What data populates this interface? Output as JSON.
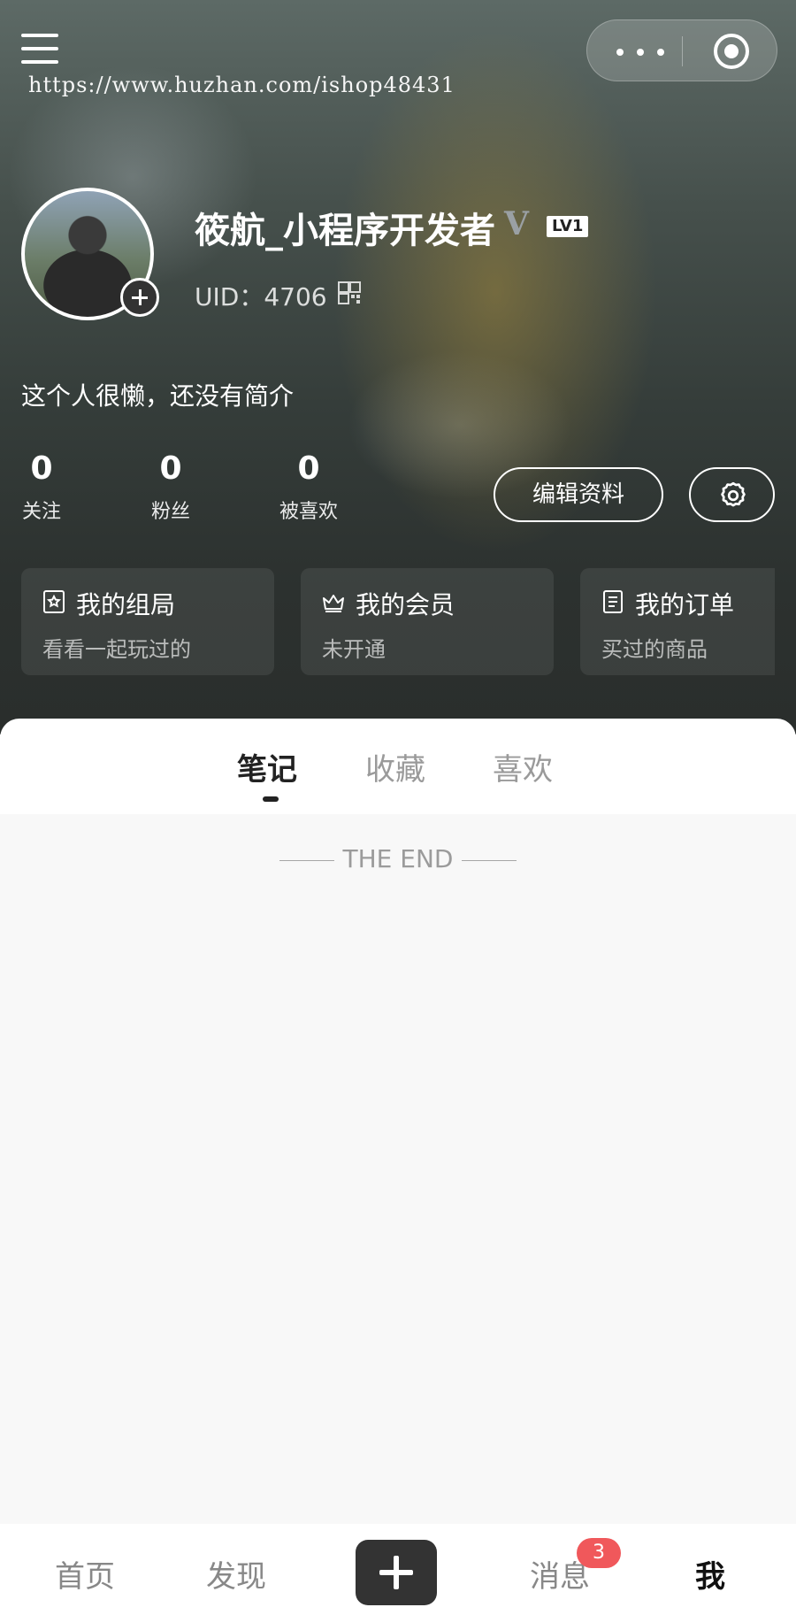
{
  "watermark": "https://www.huzhan.com/ishop48431",
  "icons": {
    "menu": "menu-icon",
    "more": "more-icon",
    "target": "target-icon",
    "verified": "verified-icon",
    "qr": "qr-code-icon",
    "settings": "gear-icon",
    "group": "star-badge-icon",
    "member": "crown-icon",
    "orders": "document-icon",
    "add": "plus-icon"
  },
  "profile": {
    "username": "筱航_小程序开发者",
    "verified_mark": "V",
    "level": "LV1",
    "uid": "UID：4706",
    "bio": "这个人很懒，还没有简介"
  },
  "stats": [
    {
      "value": "0",
      "label": "关注"
    },
    {
      "value": "0",
      "label": "粉丝"
    },
    {
      "value": "0",
      "label": "被喜欢"
    }
  ],
  "actions": {
    "edit_profile": "编辑资料"
  },
  "cards": [
    {
      "title": "我的组局",
      "subtitle": "看看一起玩过的"
    },
    {
      "title": "我的会员",
      "subtitle": "未开通"
    },
    {
      "title": "我的订单",
      "subtitle": "买过的商品"
    }
  ],
  "content_tabs": [
    {
      "label": "笔记",
      "active": true
    },
    {
      "label": "收藏",
      "active": false
    },
    {
      "label": "喜欢",
      "active": false
    }
  ],
  "end_text": "THE END",
  "bottom_nav": [
    {
      "label": "首页"
    },
    {
      "label": "发现"
    },
    {
      "label": "消息",
      "badge": "3"
    },
    {
      "label": "我",
      "active": true
    }
  ],
  "colors": {
    "badge": "#f0585b",
    "post_button": "#333333"
  }
}
